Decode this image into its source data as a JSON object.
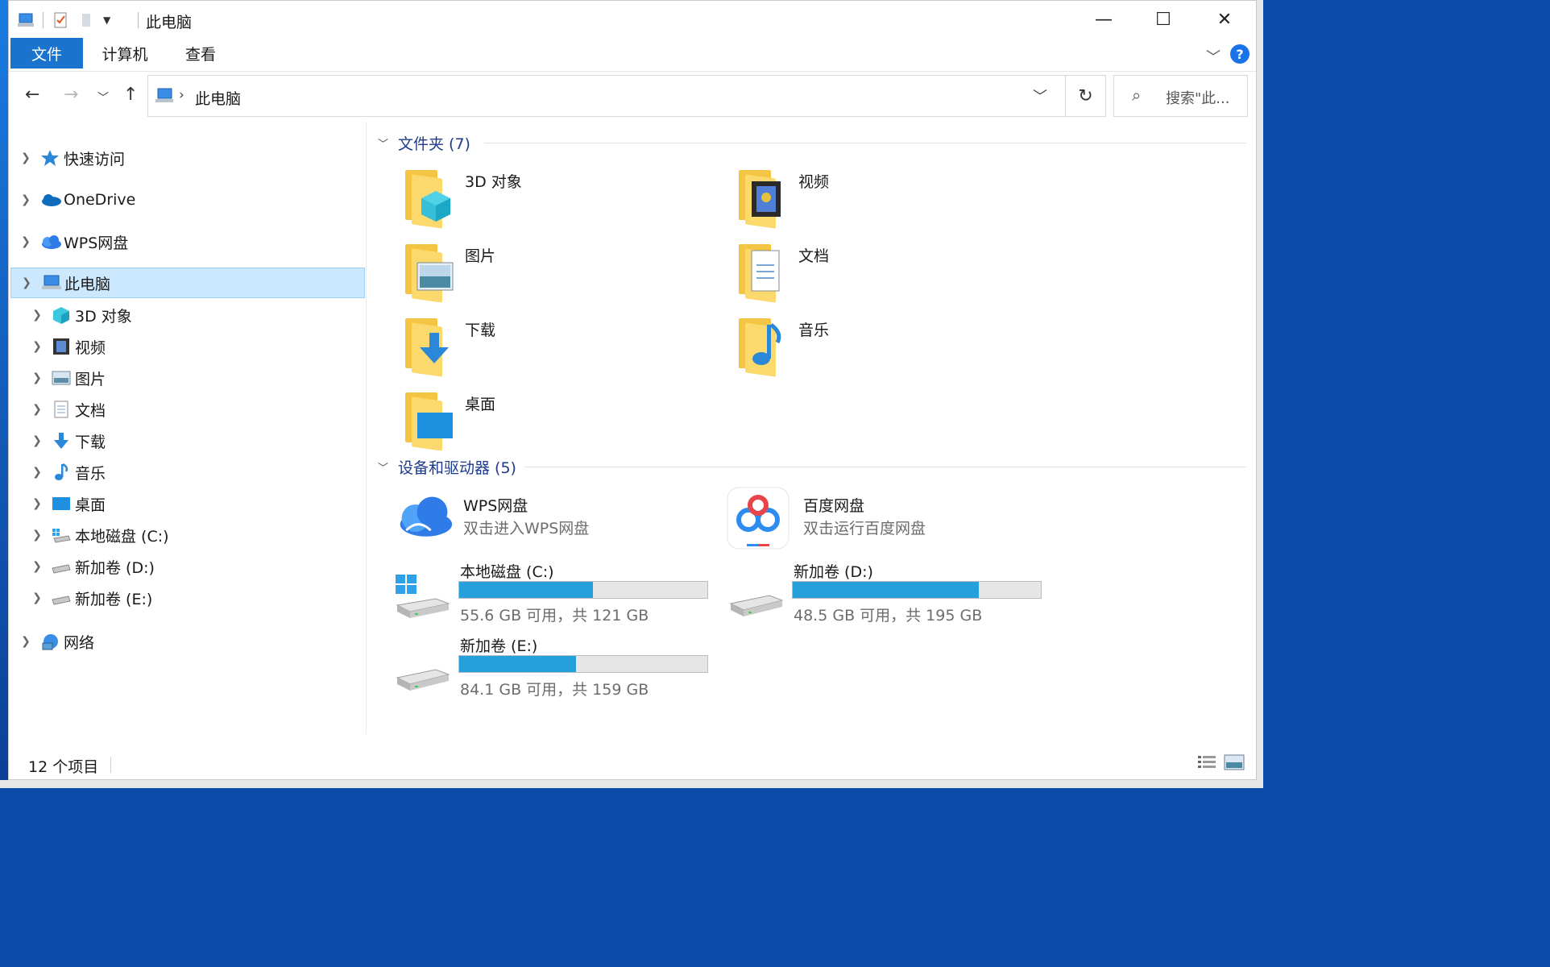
{
  "window": {
    "title": "此电脑",
    "controls": {
      "minimize": "—",
      "maximize": "☐",
      "close": "✕"
    }
  },
  "ribbon": {
    "tabs": [
      "文件",
      "计算机",
      "查看"
    ],
    "collapse_icon": "chevron-down-icon",
    "help_label": "?"
  },
  "address": {
    "path": "此电脑",
    "separator": "›",
    "search_placeholder": "搜索\"此..."
  },
  "nav": {
    "items": [
      {
        "label": "快速访问",
        "icon": "star-icon",
        "level": 0,
        "expanded": false
      },
      {
        "label": "OneDrive",
        "icon": "onedrive-cloud-icon",
        "level": 0,
        "expanded": false
      },
      {
        "label": "WPS网盘",
        "icon": "wps-cloud-icon",
        "level": 0,
        "expanded": false
      },
      {
        "label": "此电脑",
        "icon": "computer-icon",
        "level": 0,
        "expanded": true,
        "selected": true
      },
      {
        "label": "3D 对象",
        "icon": "3d-objects-icon",
        "level": 1
      },
      {
        "label": "视频",
        "icon": "video-icon",
        "level": 1
      },
      {
        "label": "图片",
        "icon": "pictures-icon",
        "level": 1
      },
      {
        "label": "文档",
        "icon": "documents-icon",
        "level": 1
      },
      {
        "label": "下载",
        "icon": "download-icon",
        "level": 1
      },
      {
        "label": "音乐",
        "icon": "music-icon",
        "level": 1
      },
      {
        "label": "桌面",
        "icon": "desktop-icon",
        "level": 1
      },
      {
        "label": "本地磁盘 (C:)",
        "icon": "local-disk-icon",
        "level": 1
      },
      {
        "label": "新加卷 (D:)",
        "icon": "drive-icon",
        "level": 1
      },
      {
        "label": "新加卷 (E:)",
        "icon": "drive-icon",
        "level": 1
      },
      {
        "label": "网络",
        "icon": "network-icon",
        "level": 0,
        "expanded": false
      }
    ]
  },
  "content": {
    "folders_group": "文件夹 (7)",
    "folders": [
      {
        "name": "3D 对象",
        "icon": "3d-objects-folder-icon"
      },
      {
        "name": "视频",
        "icon": "video-folder-icon"
      },
      {
        "name": "图片",
        "icon": "pictures-folder-icon"
      },
      {
        "name": "文档",
        "icon": "documents-folder-icon"
      },
      {
        "name": "下载",
        "icon": "download-folder-icon"
      },
      {
        "name": "音乐",
        "icon": "music-folder-icon"
      },
      {
        "name": "桌面",
        "icon": "desktop-folder-icon"
      }
    ],
    "devices_group": "设备和驱动器 (5)",
    "apps": [
      {
        "name": "WPS网盘",
        "sub": "双击进入WPS网盘",
        "icon": "wps-cloud-icon"
      },
      {
        "name": "百度网盘",
        "sub": "双击运行百度网盘",
        "icon": "baidu-netdisk-icon"
      }
    ],
    "drives": [
      {
        "name": "本地磁盘 (C:)",
        "free_text": "55.6 GB 可用，共 121 GB",
        "used_fraction": 0.54,
        "icon": "windows-drive-icon"
      },
      {
        "name": "新加卷 (D:)",
        "free_text": "48.5 GB 可用，共 195 GB",
        "used_fraction": 0.75,
        "icon": "drive-icon"
      },
      {
        "name": "新加卷 (E:)",
        "free_text": "84.1 GB 可用，共 159 GB",
        "used_fraction": 0.47,
        "icon": "drive-icon"
      }
    ]
  },
  "status": {
    "item_count": "12 个项目",
    "views": [
      "details-view-icon",
      "large-icons-view-icon"
    ]
  },
  "colors": {
    "accent": "#1a73cc",
    "selection": "#cce8ff",
    "drive_bar": "#26a0da",
    "group_header": "#1e3a8a"
  }
}
